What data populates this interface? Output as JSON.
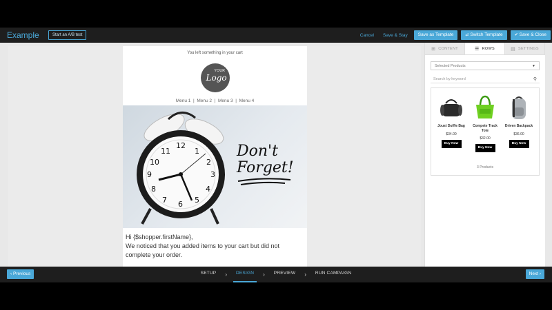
{
  "header": {
    "title": "Example",
    "ab_test_label": "Start an A/B test",
    "cancel_label": "Cancel",
    "save_stay_label": "Save & Stay",
    "save_template_label": "Save as Template",
    "switch_template_label": "Switch Template",
    "save_close_label": "Save & Close",
    "accent_color": "#4aa8d8"
  },
  "email": {
    "preheader": "You left something in your cart",
    "logo_small": "YOUR",
    "logo_large": "Logo",
    "menu": [
      "Menu 1",
      "Menu 2",
      "Menu 3",
      "Menu 4"
    ],
    "menu_separator": "|",
    "hero_text_line1": "Don't",
    "hero_text_line2": "Forget!",
    "greeting": "Hi {$shopper.firstName},",
    "body": "We noticed that you added items to your cart but did not complete your order."
  },
  "panel": {
    "tabs": [
      {
        "label": "CONTENT",
        "icon": "grid-icon",
        "active": false
      },
      {
        "label": "ROWS",
        "icon": "rows-icon",
        "active": true
      },
      {
        "label": "SETTINGS",
        "icon": "settings-icon",
        "active": false
      }
    ],
    "select_value": "Selected Products",
    "search_placeholder": "Search by keyword",
    "products": [
      {
        "name": "Joust Duffle Bag",
        "price": "$34.00",
        "button": "Buy Now"
      },
      {
        "name": "Compete Track Tote",
        "price": "$32.00",
        "button": "Buy Now"
      },
      {
        "name": "Driven Backpack",
        "price": "$36.00",
        "button": "Buy Now"
      }
    ],
    "product_count": "3 Products"
  },
  "footer": {
    "previous_label": "Previous",
    "next_label": "Next",
    "steps": [
      "SETUP",
      "DESIGN",
      "PREVIEW",
      "RUN CAMPAIGN"
    ],
    "active_step": "DESIGN"
  }
}
